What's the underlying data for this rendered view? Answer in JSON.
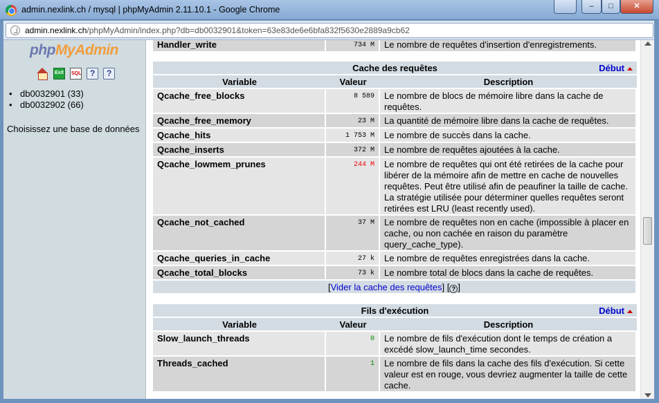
{
  "window": {
    "title": "admin.nexlink.ch / mysql | phpMyAdmin 2.11.10.1 - Google Chrome",
    "buttons": {
      "b1": "",
      "minimize": "–",
      "maximize": "□",
      "close": "✕"
    }
  },
  "urlbar": {
    "host": "admin.nexlink.ch",
    "rest": "/phpMyAdmin/index.php?db=db0032901&token=63e83de6e6bfa832f5630e2889a9cb62"
  },
  "left": {
    "logo": {
      "php": "php",
      "my": "My",
      "admin": "Admin"
    },
    "nav_icons": [
      "home-icon",
      "exit-icon",
      "sql-query-icon",
      "help-icon",
      "docs-icon"
    ],
    "databases": [
      "db0032901 (33)",
      "db0032902 (66)"
    ],
    "choose_db": "Choisissez une base de données"
  },
  "handler_row": {
    "variable": "Handler_write",
    "value": "734 M",
    "description": "Le nombre de requêtes d'insertion d'enregistrements."
  },
  "cache": {
    "title": "Cache des requêtes",
    "debut": "Début",
    "headers": {
      "variable": "Variable",
      "valeur": "Valeur",
      "description": "Description"
    },
    "rows": [
      {
        "variable": "Qcache_free_blocks",
        "value": "8 589",
        "description": "Le nombre de blocs de mémoire libre dans la cache de requêtes."
      },
      {
        "variable": "Qcache_free_memory",
        "value": "23 M",
        "description": "La quantité de mémoire libre dans la cache de requêtes."
      },
      {
        "variable": "Qcache_hits",
        "value": "1 753 M",
        "description": "Le nombre de succès dans la cache."
      },
      {
        "variable": "Qcache_inserts",
        "value": "372 M",
        "description": "Le nombre de requêtes ajoutées à la cache."
      },
      {
        "variable": "Qcache_lowmem_prunes",
        "value": "244 M",
        "description": "Le nombre de requêtes qui ont été retirées de la cache pour libérer de la mémoire afin de mettre en cache de nouvelles requêtes. Peut être utilisé afin de peaufiner la taille de cache. La stratégie utilisée pour déterminer quelles requêtes seront retirées est LRU (least recently used)."
      },
      {
        "variable": "Qcache_not_cached",
        "value": "37 M",
        "description": "Le nombre de requêtes non en cache (impossible à placer en cache, ou non cachée en raison du paramètre query_cache_type)."
      },
      {
        "variable": "Qcache_queries_in_cache",
        "value": "27 k",
        "description": "Le nombre de requêtes enregistrées dans la cache."
      },
      {
        "variable": "Qcache_total_blocks",
        "value": "73 k",
        "description": "Le nombre total de blocs dans la cache de requêtes."
      }
    ],
    "action": {
      "pre": "[",
      "link": "Vider la cache des requêtes",
      "mid": "] [",
      "post": "]"
    }
  },
  "threads": {
    "title": "Fils d'exécution",
    "debut": "Début",
    "headers": {
      "variable": "Variable",
      "valeur": "Valeur",
      "description": "Description"
    },
    "rows": [
      {
        "variable": "Slow_launch_threads",
        "value": "0",
        "description": "Le nombre de fils d'exécution dont le temps de création a excédé slow_launch_time secondes."
      },
      {
        "variable": "Threads_cached",
        "value": "1",
        "description": "Le nombre de fils dans la cache des fils d'exécution. Si cette valeur est en rouge, vous devriez augmenter la taille de cette cache."
      }
    ]
  },
  "colors": {
    "header_bg": "#d3dce3",
    "row_light": "#e5e5e5",
    "row_dark": "#d5d5d5",
    "link": "#0000cc",
    "warning_value": "#ee0000",
    "ok_value": "#008800"
  }
}
